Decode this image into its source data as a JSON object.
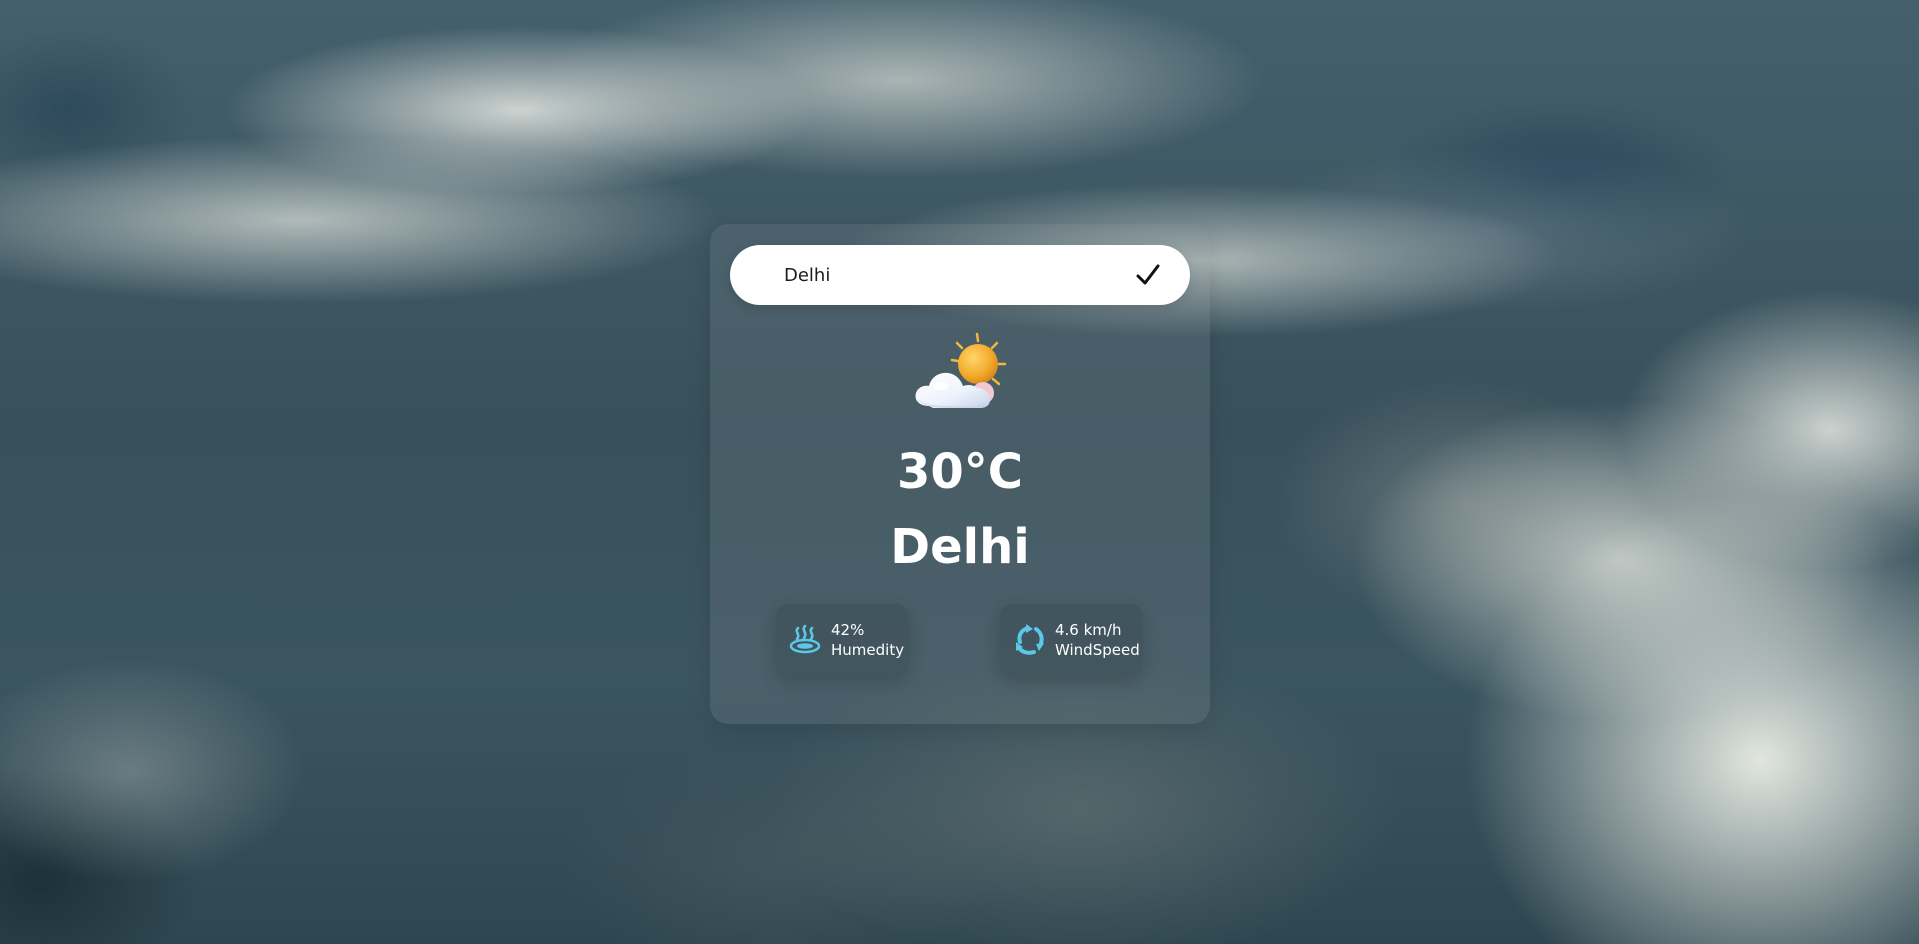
{
  "search": {
    "value": "Delhi",
    "button_icon": "check-icon"
  },
  "weather": {
    "condition_icon": "partly-cloudy-icon",
    "temperature": "30°C",
    "city": "Delhi"
  },
  "stats": {
    "humidity": {
      "value": "42%",
      "label": "Humedity",
      "icon": "water-icon"
    },
    "wind": {
      "value": "4.6 km/h",
      "label": "WindSpeed",
      "icon": "wind-icon"
    }
  },
  "colors": {
    "accent": "#5bc8ea",
    "sun": "#f2a72a",
    "card": "#80898c"
  }
}
